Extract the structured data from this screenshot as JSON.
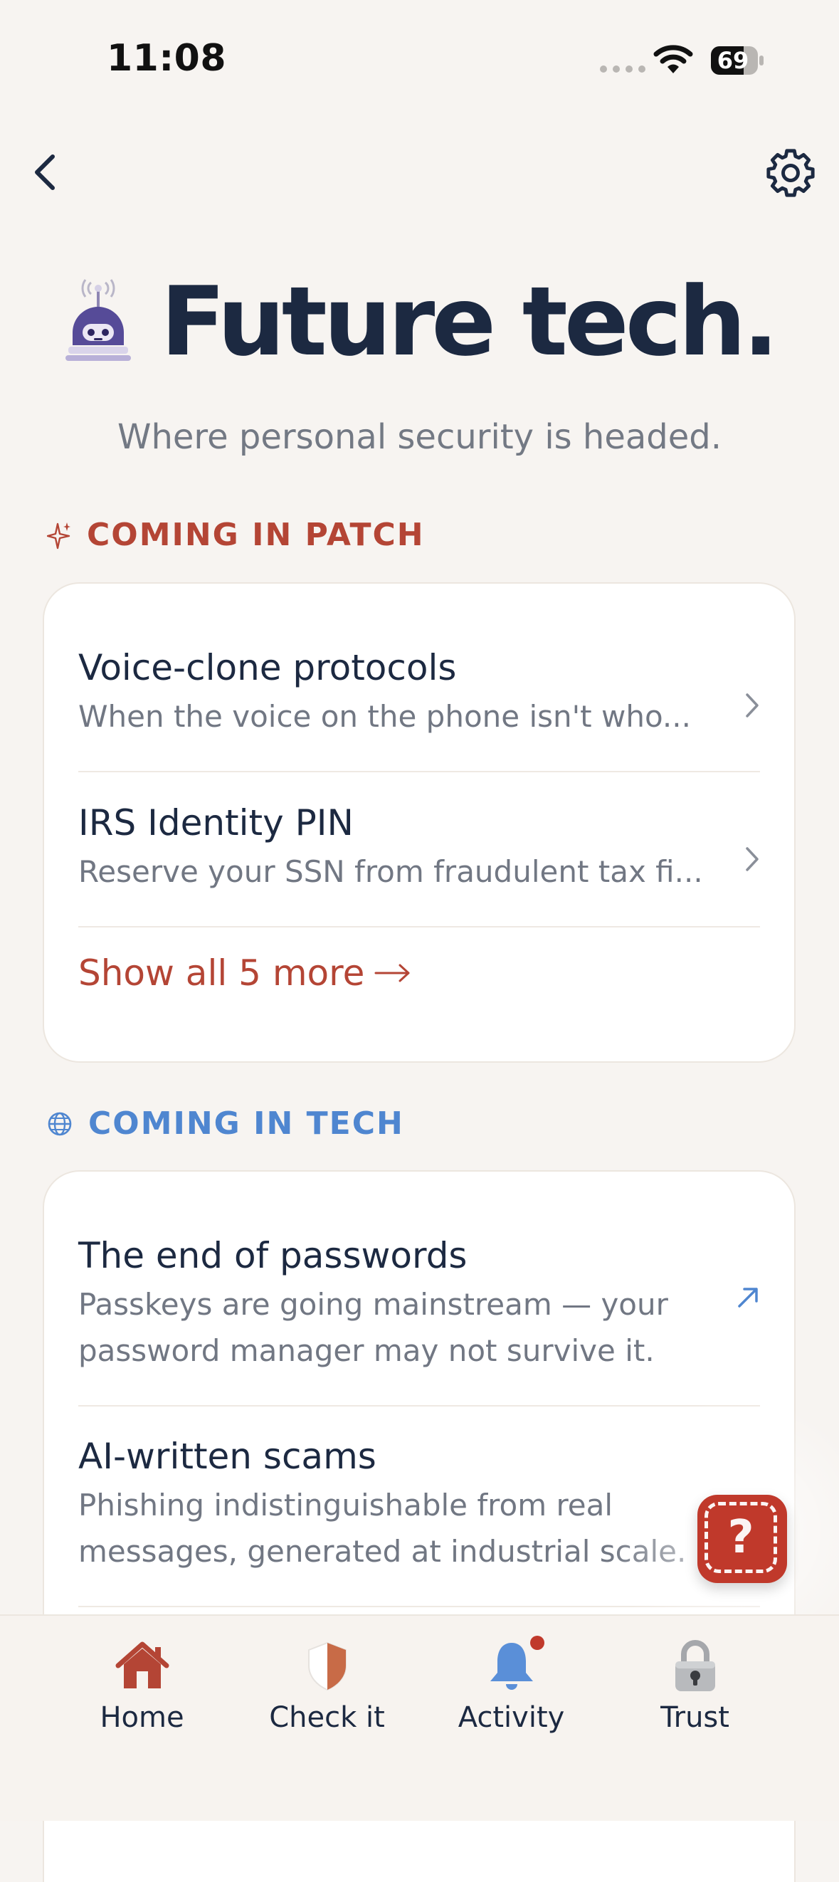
{
  "status_bar": {
    "time": "11:08",
    "battery": "69"
  },
  "header": {
    "title": "Future tech.",
    "subtitle": "Where personal security is headed."
  },
  "sections": {
    "patch": {
      "label": "COMING IN PATCH",
      "color": "#b44535",
      "items": [
        {
          "title": "Voice-clone protocols",
          "subtitle": "When the voice on the phone isn't who..."
        },
        {
          "title": "IRS Identity PIN",
          "subtitle": "Reserve your SSN from fraudulent tax fi..."
        }
      ],
      "show_more": "Show all 5 more"
    },
    "tech": {
      "label": "COMING IN TECH",
      "color": "#4f86d0",
      "items": [
        {
          "title": "The end of passwords",
          "subtitle_line1": "Passkeys are going mainstream — your",
          "subtitle_line2": "password manager may not survive it."
        },
        {
          "title": "AI-written scams",
          "subtitle_line1": "Phishing indistinguishable from real",
          "subtitle_line2": "messages, generated at industrial scale."
        }
      ]
    }
  },
  "help_button": {
    "label": "?"
  },
  "tab_bar": {
    "tabs": [
      {
        "label": "Home",
        "icon": "house-icon"
      },
      {
        "label": "Check it",
        "icon": "shield-icon"
      },
      {
        "label": "Activity",
        "icon": "bell-icon"
      },
      {
        "label": "Trust",
        "icon": "padlock-icon"
      }
    ]
  }
}
